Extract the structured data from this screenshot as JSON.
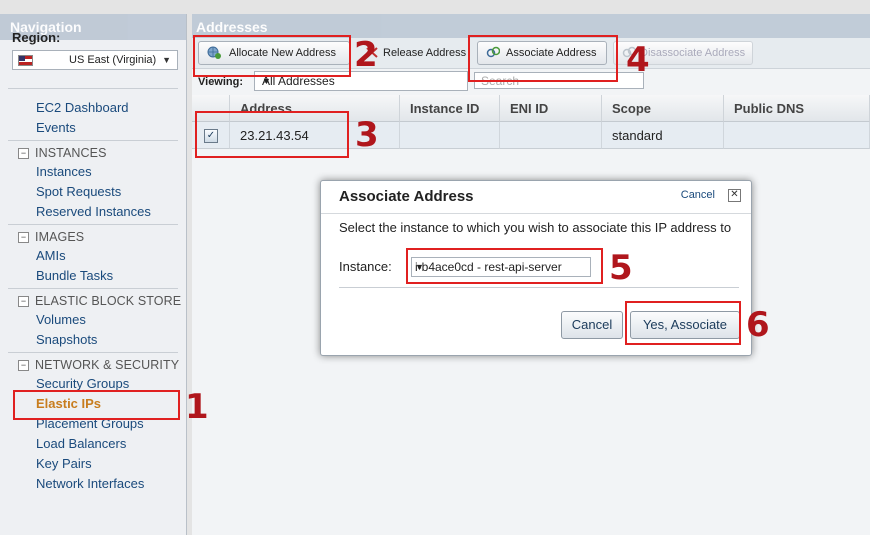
{
  "sidebar": {
    "title": "Navigation",
    "region_label": "Region:",
    "region_value": "US East (Virginia)",
    "items": {
      "ec2_dashboard": "EC2 Dashboard",
      "events": "Events",
      "instances_section": "INSTANCES",
      "instances": "Instances",
      "spot_requests": "Spot Requests",
      "reserved_instances": "Reserved Instances",
      "images_section": "IMAGES",
      "amis": "AMIs",
      "bundle_tasks": "Bundle Tasks",
      "ebs_section": "ELASTIC BLOCK STORE",
      "volumes": "Volumes",
      "snapshots": "Snapshots",
      "network_section": "NETWORK & SECURITY",
      "security_groups": "Security Groups",
      "elastic_ips": "Elastic IPs",
      "placement_groups": "Placement Groups",
      "load_balancers": "Load Balancers",
      "key_pairs": "Key Pairs",
      "network_interfaces": "Network Interfaces"
    }
  },
  "main": {
    "title": "Addresses",
    "toolbar": {
      "allocate": "Allocate New Address",
      "release": "Release Address",
      "associate": "Associate Address",
      "disassociate": "Disassociate Address"
    },
    "viewing_label": "Viewing:",
    "viewing_value": "All Addresses",
    "search_placeholder": "Search",
    "columns": [
      "Address",
      "Instance ID",
      "ENI ID",
      "Scope",
      "Public DNS"
    ],
    "rows": [
      {
        "selected": true,
        "address": "23.21.43.54",
        "instance_id": "",
        "eni_id": "",
        "scope": "standard",
        "public_dns": ""
      }
    ]
  },
  "modal": {
    "title": "Associate Address",
    "cancel_link": "Cancel",
    "close_glyph": "✕",
    "message": "Select the instance to which you wish to associate this IP address to",
    "instance_label": "Instance:",
    "instance_value": "i-b4ace0cd - rest-api-server",
    "cancel_button": "Cancel",
    "confirm_button": "Yes, Associate"
  },
  "annotations": {
    "step1": "1",
    "step2": "2",
    "step3": "3",
    "step4": "4",
    "step5": "5",
    "step6": "6",
    "color": "#e02020"
  },
  "colors": {
    "header_bar": "#b8c4d2",
    "link": "#1a4a7c",
    "active_item": "#c87d1e",
    "selected_row": "#e6ecf2"
  }
}
